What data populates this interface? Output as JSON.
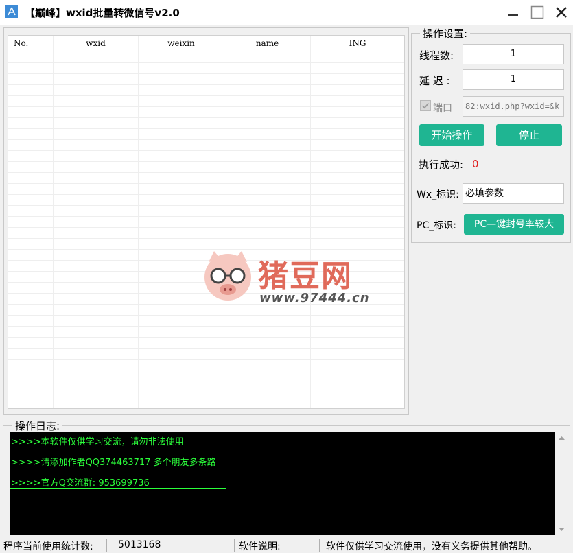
{
  "window": {
    "title": "【巅峰】wxid批量转微信号v2.0"
  },
  "grid": {
    "columns": [
      "No.",
      "wxid",
      "weixin",
      "name",
      "ING"
    ],
    "rows": []
  },
  "settings": {
    "legend": "操作设置:",
    "thread_label": "线程数:",
    "thread_value": "1",
    "delay_label": "延 迟 :",
    "delay_value": "1",
    "port_label": "端口",
    "port_checked": true,
    "port_value": "82:wxid.php?wxid=&k",
    "start_button": "开始操作",
    "stop_button": "停止",
    "success_label": "执行成功:",
    "success_value": "0",
    "wx_label": "Wx_标识:",
    "wx_value": "必填参数",
    "pc_label": "PC_标识:",
    "pc_button": "PC—键封号率较大"
  },
  "watermark": {
    "brand": "猪豆网",
    "url": "www.97444.cn"
  },
  "log": {
    "legend": "操作日志:",
    "lines": [
      ">>>>本软件仅供学习交流，请勿非法使用",
      ">>>>请添加作者QQ374463717 多个朋友多条路",
      ">>>>官方Q交流群: 953699736"
    ]
  },
  "status": {
    "count_label": "程序当前使用统计数:",
    "count_value": "5013168",
    "info_label": "软件说明:",
    "info_value": "软件仅供学习交流使用，没有义务提供其他帮助。"
  },
  "colors": {
    "accent": "#1fb592",
    "log_text": "#2bff3b",
    "success": "#e02020"
  }
}
